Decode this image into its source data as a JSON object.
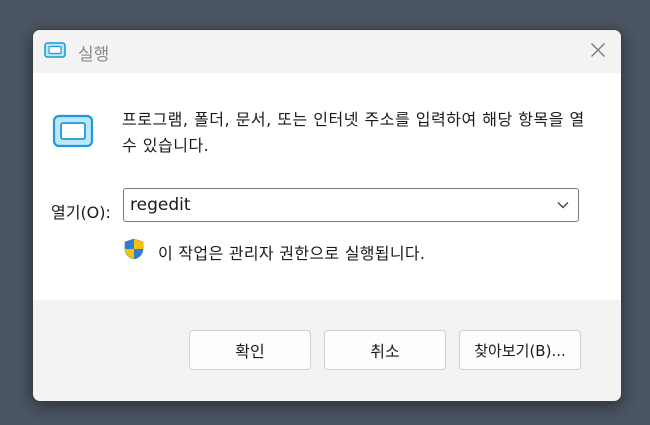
{
  "window": {
    "title": "실행",
    "close_glyph": "✕"
  },
  "content": {
    "description": "프로그램, 폴더, 문서, 또는 인터넷 주소를 입력하여 해당 항목을 열 수 있습니다.",
    "open_label": "열기(O):",
    "open_value": "regedit",
    "admin_note": "이 작업은 관리자 권한으로 실행됩니다."
  },
  "buttons": {
    "ok": "확인",
    "cancel": "취소",
    "browse": "찾아보기(B)..."
  },
  "icons": {
    "title": "run-icon",
    "main": "run-icon",
    "admin": "uac-shield-icon",
    "dropdown": "chevron-down-icon",
    "close": "close-icon"
  },
  "colors": {
    "window_bg": "#f3f3f3",
    "content_bg": "#ffffff",
    "desktop_bg": "#4b5563",
    "title_text": "#8a8a8a",
    "run_icon_blue": "#1e9bd7"
  }
}
